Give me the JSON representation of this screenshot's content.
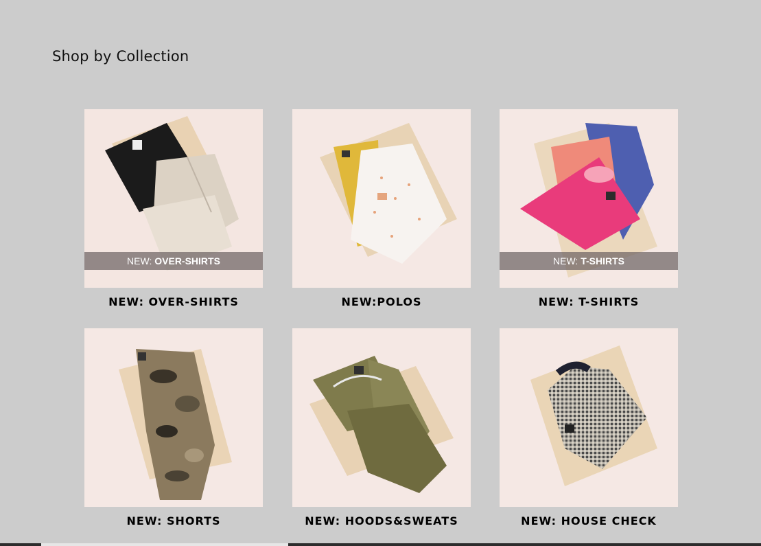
{
  "heading": "Shop by Collection",
  "collections": [
    {
      "caption": "NEW: OVER-SHIRTS",
      "overlay_prefix": "NEW: ",
      "overlay_bold": "OVER-SHIRTS",
      "image": "over-shirts-image"
    },
    {
      "caption": "NEW:POLOS",
      "image": "polos-image"
    },
    {
      "caption": "NEW: T-SHIRTS",
      "overlay_prefix": "NEW: ",
      "overlay_bold": "T-SHIRTS",
      "image": "t-shirts-image"
    },
    {
      "caption": "NEW: SHORTS",
      "image": "shorts-image"
    },
    {
      "caption": "NEW: HOODS&SWEATS",
      "image": "hoods-sweats-image"
    },
    {
      "caption": "NEW: HOUSE CHECK",
      "image": "house-check-image"
    }
  ],
  "colors": {
    "background": "#cccccc",
    "tile_bg": "#f3e3de",
    "overlay": "#6e6464"
  }
}
